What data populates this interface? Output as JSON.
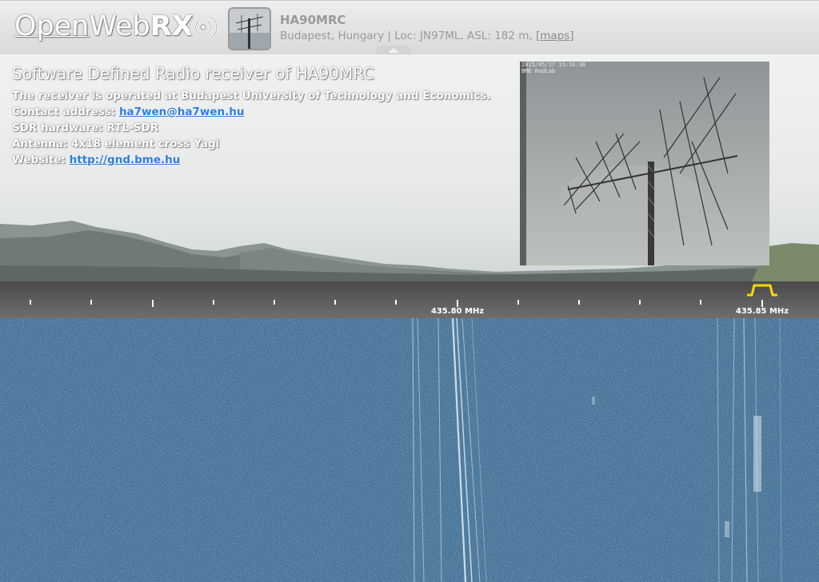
{
  "header": {
    "logo": {
      "part1": "Open",
      "part2": "Web",
      "part3": "RX"
    },
    "receiver_title": "HA90MRC",
    "receiver_desc": "Budapest, Hungary | Loc: JN97ML, ASL: 182 m, ",
    "maps_link": "[maps]"
  },
  "info": {
    "title": "Software Defined Radio receiver of HA90MRC",
    "line1": "The receiver is operated at Budapest University of Technology and Economics.",
    "contact_label": "Contact address: ",
    "contact_email": "ha7wen@ha7wen.hu",
    "hardware": "SDR hardware: RTL-SDR",
    "antenna": "Antenna: 4x18 element cross Yagi",
    "website_label": "Website: ",
    "website_url": "http://gnd.bme.hu"
  },
  "webcam": {
    "timestamp": "2015/05/17 15:16:38",
    "caption": "BME RadLab"
  },
  "scale": {
    "labels": [
      {
        "text": "435.80 MHz"
      },
      {
        "text": "435.85 MHz"
      }
    ]
  },
  "colors": {
    "link": "#2c7fe0",
    "filter_marker": "#ffd800",
    "waterfall": "#3d6a8f"
  },
  "icons": {
    "logo": "radio-waves-icon",
    "collapse": "chevron-up-icon"
  }
}
